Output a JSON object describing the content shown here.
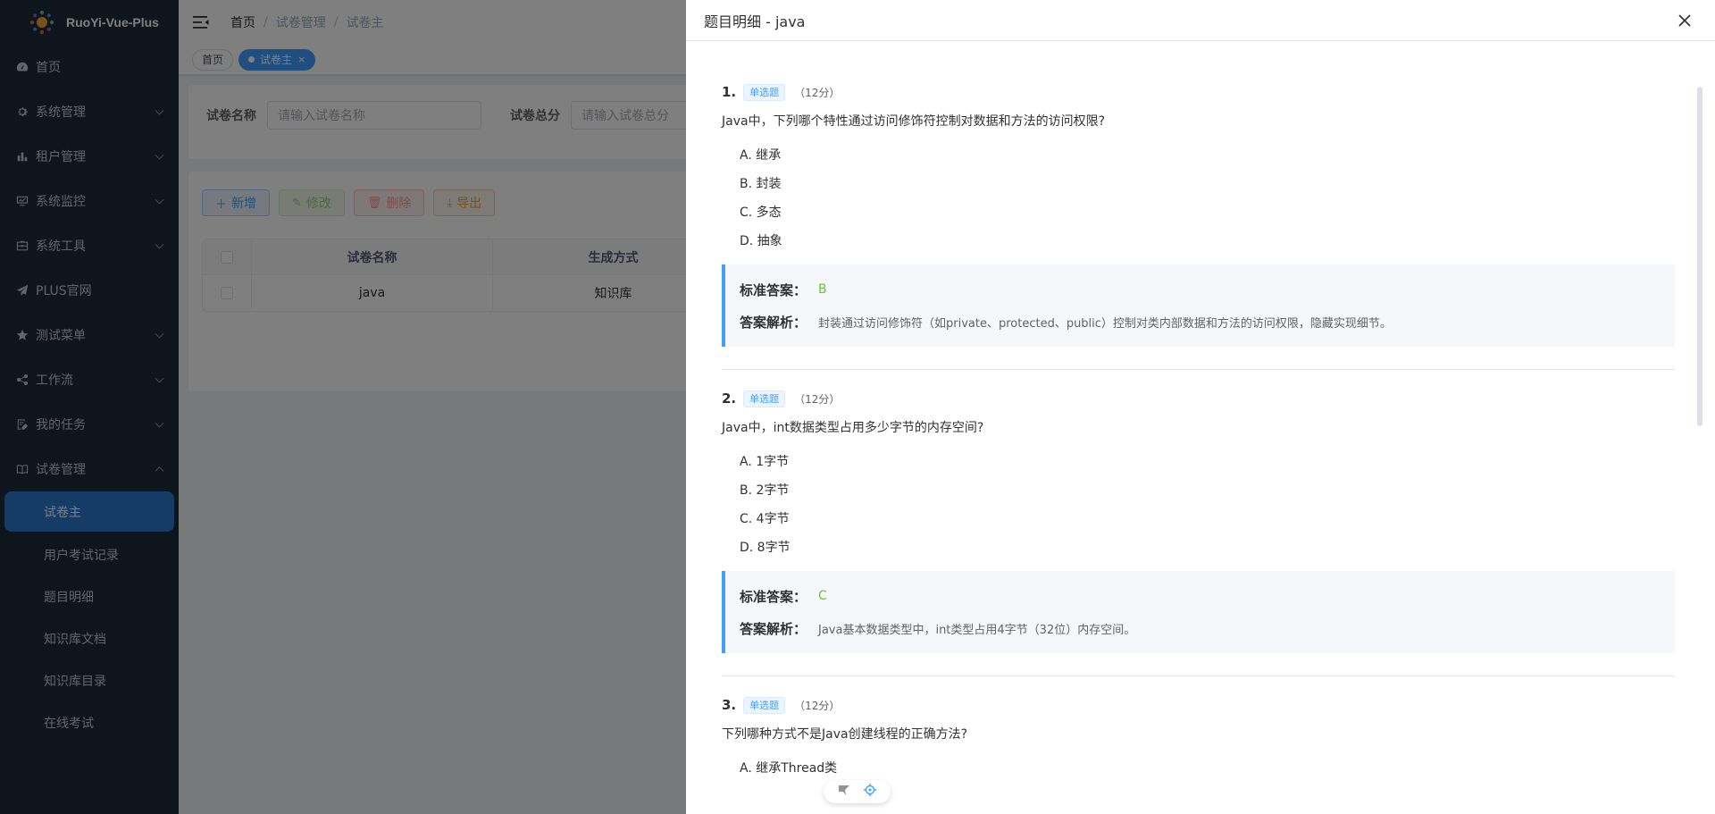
{
  "app": {
    "name": "RuoYi-Vue-Plus"
  },
  "sidebar": {
    "items": [
      {
        "label": "首页",
        "icon": "dashboard-icon",
        "expandable": false
      },
      {
        "label": "系统管理",
        "icon": "gear-icon",
        "expandable": true
      },
      {
        "label": "租户管理",
        "icon": "bar-chart-icon",
        "expandable": true
      },
      {
        "label": "系统监控",
        "icon": "monitor-icon",
        "expandable": true
      },
      {
        "label": "系统工具",
        "icon": "toolbox-icon",
        "expandable": true
      },
      {
        "label": "PLUS官网",
        "icon": "paper-plane-icon",
        "expandable": false
      },
      {
        "label": "测试菜单",
        "icon": "star-icon",
        "expandable": true
      },
      {
        "label": "工作流",
        "icon": "share-icon",
        "expandable": true
      },
      {
        "label": "我的任务",
        "icon": "task-icon",
        "expandable": true
      },
      {
        "label": "试卷管理",
        "icon": "book-icon",
        "expandable": true,
        "expanded": true
      }
    ],
    "subitems": [
      {
        "label": "试卷主",
        "active": true
      },
      {
        "label": "用户考试记录"
      },
      {
        "label": "题目明细"
      },
      {
        "label": "知识库文档"
      },
      {
        "label": "知识库目录"
      },
      {
        "label": "在线考试"
      }
    ]
  },
  "navbar": {
    "breadcrumb": [
      "首页",
      "试卷管理",
      "试卷主"
    ]
  },
  "tags": [
    {
      "label": "首页",
      "active": false
    },
    {
      "label": "试卷主",
      "active": true
    }
  ],
  "search": {
    "fields": [
      {
        "label": "试卷名称",
        "placeholder": "请输入试卷名称"
      },
      {
        "label": "试卷总分",
        "placeholder": "请输入试卷总分"
      }
    ]
  },
  "toolbar": {
    "add": "新增",
    "edit": "修改",
    "delete": "删除",
    "export": "导出"
  },
  "table": {
    "headers": [
      "试卷名称",
      "生成方式"
    ],
    "rows": [
      [
        "java",
        "知识库"
      ]
    ]
  },
  "drawer": {
    "title": "题目明细 - java",
    "answer_label": "标准答案：",
    "explain_label": "答案解析：",
    "questions": [
      {
        "no": "1.",
        "type": "单选题",
        "score": "（12分）",
        "text": "Java中，下列哪个特性通过访问修饰符控制对数据和方法的访问权限?",
        "options": [
          "A. 继承",
          "B. 封装",
          "C. 多态",
          "D. 抽象"
        ],
        "answer": "B",
        "explanation": "封装通过访问修饰符（如private、protected、public）控制对类内部数据和方法的访问权限，隐藏实现细节。"
      },
      {
        "no": "2.",
        "type": "单选题",
        "score": "（12分）",
        "text": "Java中，int数据类型占用多少字节的内存空间?",
        "options": [
          "A. 1字节",
          "B. 2字节",
          "C. 4字节",
          "D. 8字节"
        ],
        "answer": "C",
        "explanation": "Java基本数据类型中，int类型占用4字节（32位）内存空间。"
      },
      {
        "no": "3.",
        "type": "单选题",
        "score": "（12分）",
        "text": "下列哪种方式不是Java创建线程的正确方法?",
        "options": [
          "A. 继承Thread类"
        ]
      }
    ]
  },
  "colors": {
    "sidebar_bg": "#1d2b3a",
    "accent": "#409eff",
    "answer_green": "#67c23a"
  }
}
